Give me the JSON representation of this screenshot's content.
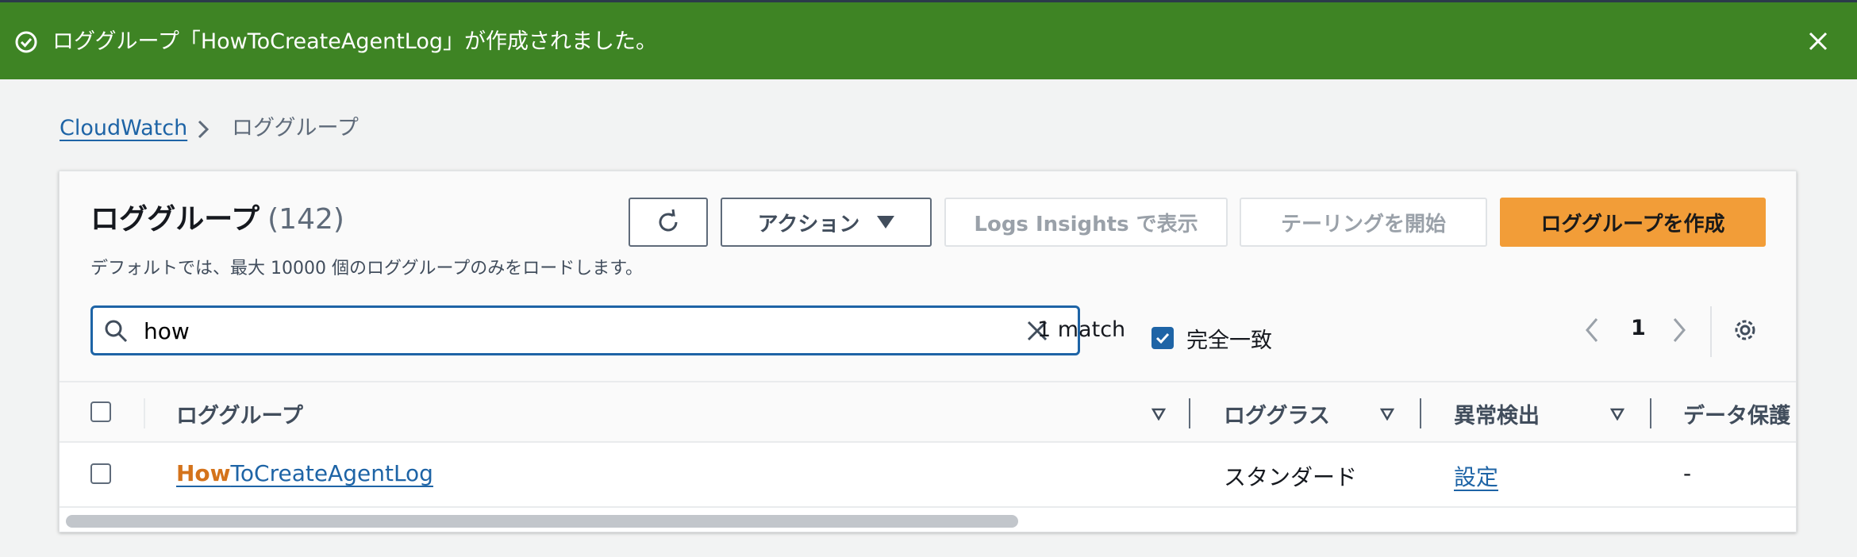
{
  "flash": {
    "message": "ロググループ「HowToCreateAgentLog」が作成されました。",
    "icon": "check-circle-icon",
    "close_icon": "close-icon",
    "color": "#3e8424"
  },
  "breadcrumb": {
    "root": "CloudWatch",
    "current": "ロググループ"
  },
  "panel": {
    "title": "ロググループ",
    "count": "(142)",
    "description": "デフォルトでは、最大 10000 個のロググループのみをロードします。"
  },
  "actions": {
    "refresh_icon": "refresh-icon",
    "actions_label": "アクション",
    "logs_insights_label": "Logs Insights で表示",
    "tailing_label": "テーリングを開始",
    "create_label": "ロググループを作成",
    "primary_color": "#f29d38"
  },
  "filter": {
    "value": "how",
    "match_text": "1 match",
    "exact_match_label": "完全一致",
    "exact_match_checked": true
  },
  "pagination": {
    "current_page": "1"
  },
  "table": {
    "headers": [
      "ロググループ",
      "ロググループ",
      "ロググラス",
      "異常検出",
      "データ保護"
    ],
    "columns": [
      "ロググループ",
      "ロググラス",
      "異常検出",
      "データ保護"
    ],
    "rows": [
      {
        "name_highlight": "How",
        "name_rest": "ToCreateAgentLog",
        "log_class": "スタンダード",
        "anomaly": "設定",
        "data_protection": "-"
      }
    ]
  }
}
